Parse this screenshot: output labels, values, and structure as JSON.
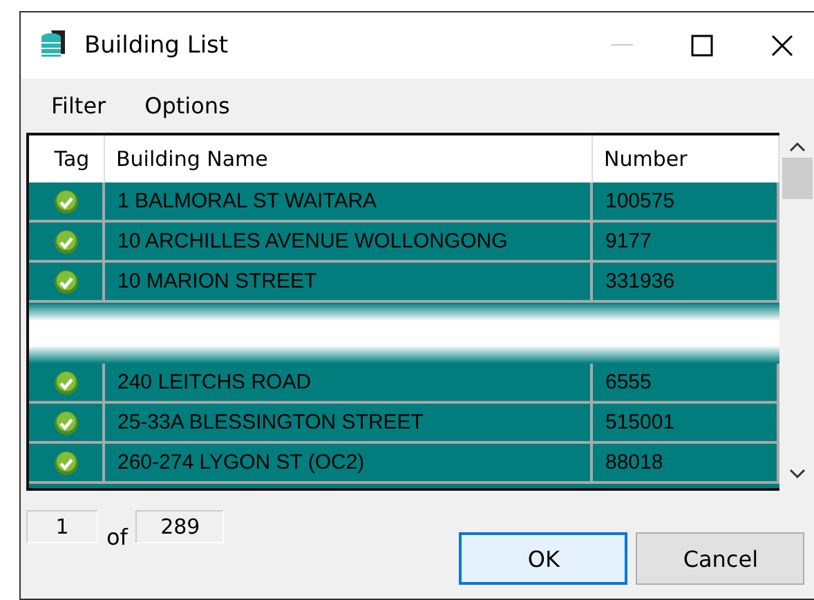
{
  "window": {
    "title": "Building List"
  },
  "menu": [
    "Filter",
    "Options"
  ],
  "table": {
    "columns": [
      "Tag",
      "Building Name",
      "Number"
    ],
    "row_groups": [
      [
        {
          "tagged": true,
          "selected": true,
          "name": "1 BALMORAL ST WAITARA",
          "number": "100575"
        },
        {
          "tagged": true,
          "selected": true,
          "name": "10 ARCHILLES AVENUE WOLLONGONG",
          "number": "9177"
        },
        {
          "tagged": true,
          "selected": true,
          "name": "10 MARION STREET",
          "number": "331936"
        }
      ],
      [
        {
          "tagged": true,
          "selected": true,
          "name": "240 LEITCHS ROAD",
          "number": "6555"
        },
        {
          "tagged": true,
          "selected": true,
          "name": "25-33A BLESSINGTON STREET",
          "number": "515001"
        },
        {
          "tagged": true,
          "selected": true,
          "name": "260-274 LYGON ST (OC2)",
          "number": "88018"
        }
      ]
    ]
  },
  "pager": {
    "current": "1",
    "of": "of",
    "total": "289"
  },
  "buttons": [
    "OK",
    "Cancel"
  ]
}
